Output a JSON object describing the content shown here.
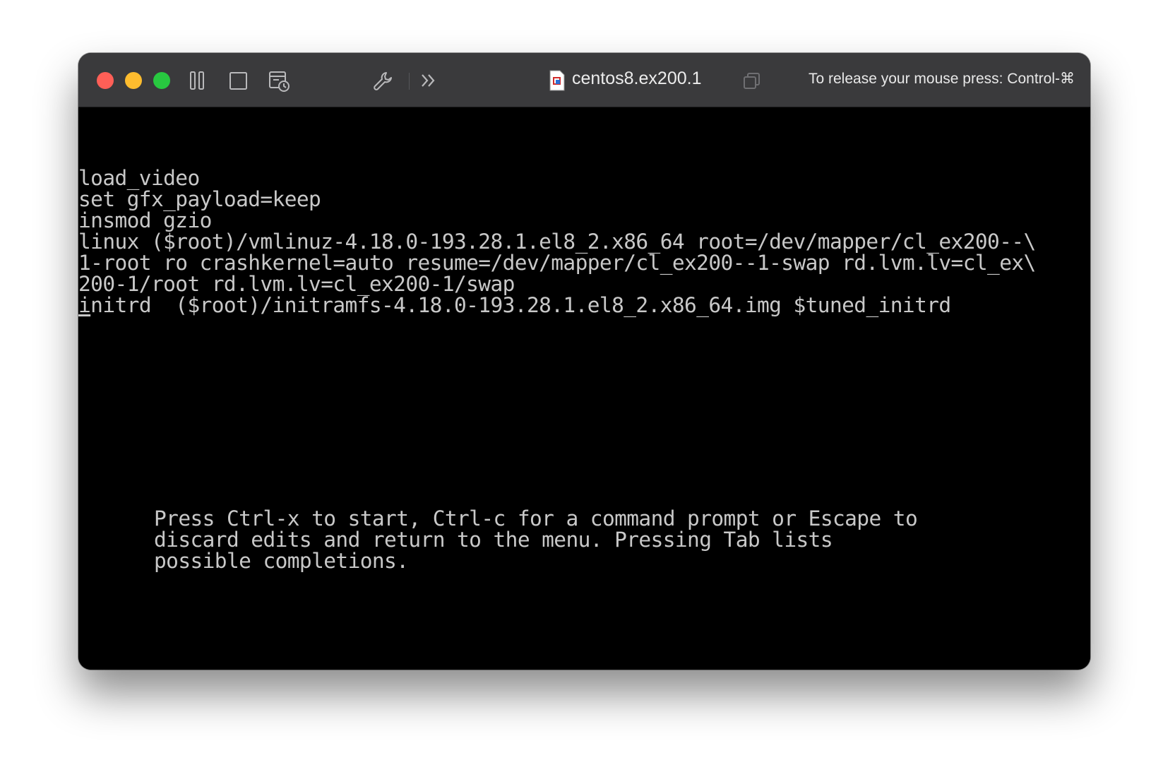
{
  "window": {
    "title": "centos8.ex200.1",
    "release_hint": "To release your mouse press: Control-⌘"
  },
  "toolbar": {
    "icons": [
      "pause-icon",
      "stop-icon",
      "snapshot-icon",
      "settings-wrench-icon",
      "more-chevrons-icon",
      "vm-file-icon",
      "copy-window-icon"
    ]
  },
  "console": {
    "lines": [
      "load_video",
      "set gfx_payload=keep",
      "insmod gzio",
      "linux ($root)/vmlinuz-4.18.0-193.28.1.el8_2.x86_64 root=/dev/mapper/cl_ex200--\\",
      "1-root ro crashkernel=auto resume=/dev/mapper/cl_ex200--1-swap rd.lvm.lv=cl_ex\\",
      "200-1/root rd.lvm.lv=cl_ex200-1/swap",
      "nitrd  ($root)/initramfs-4.18.0-193.28.1.el8_2.x86_64.img $tuned_initrd"
    ],
    "cursor_char": "i",
    "help": [
      "Press Ctrl-x to start, Ctrl-c for a command prompt or Escape to",
      "discard edits and return to the menu. Pressing Tab lists",
      "possible completions."
    ]
  },
  "colors": {
    "titlebar": "#3a3a3c",
    "close": "#ff5f57",
    "minimize": "#febc2e",
    "zoom": "#28c840",
    "console_bg": "#000000",
    "console_fg": "#c8c8c8"
  }
}
